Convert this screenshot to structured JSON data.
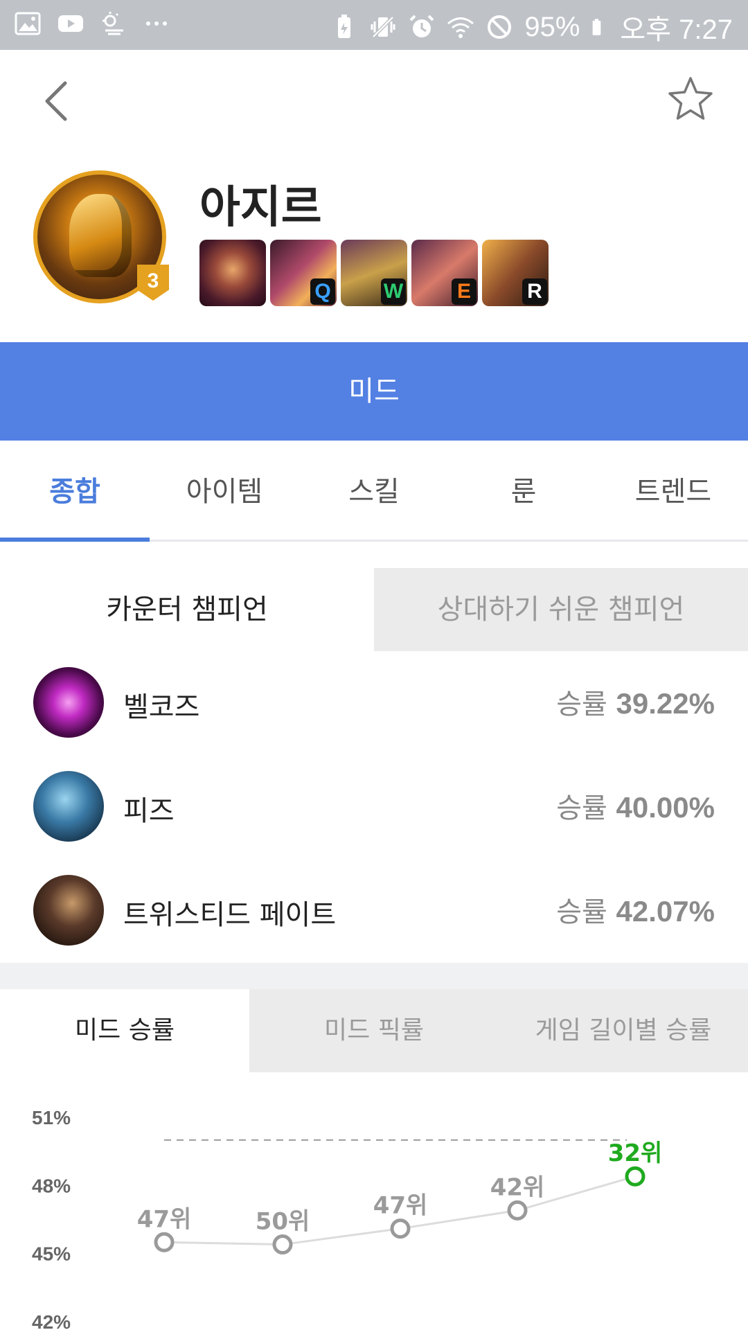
{
  "status_bar": {
    "battery": "95%",
    "time": "오후 7:27",
    "left_icons": [
      "image-icon",
      "youtube-icon",
      "weather-icon",
      "more-dots-icon"
    ],
    "right_icons": [
      "battery-saver-icon",
      "vibrate-icon",
      "alarm-icon",
      "wifi-icon",
      "blocked-icon",
      "battery-icon"
    ]
  },
  "header": {
    "back_icon": "chevron-left-icon",
    "favorite_icon": "star-outline-icon"
  },
  "champion": {
    "name": "아지르",
    "level_badge": "3",
    "skills": [
      {
        "key": "",
        "icon": "passive-skill-icon"
      },
      {
        "key": "Q",
        "color": "#3aa0ff",
        "icon": "q-skill-icon"
      },
      {
        "key": "W",
        "color": "#2ecc71",
        "icon": "w-skill-icon"
      },
      {
        "key": "E",
        "color": "#ff7a1a",
        "icon": "e-skill-icon"
      },
      {
        "key": "R",
        "color": "#ffffff",
        "icon": "r-skill-icon"
      }
    ]
  },
  "position_bar": {
    "label": "미드",
    "color": "#5380e3"
  },
  "tabs": [
    {
      "label": "종합",
      "active": true
    },
    {
      "label": "아이템",
      "active": false
    },
    {
      "label": "스킬",
      "active": false
    },
    {
      "label": "룬",
      "active": false
    },
    {
      "label": "트렌드",
      "active": false
    }
  ],
  "counter_toggle": {
    "selected": "카운터 챔피언",
    "other": "상대하기 쉬운 챔피언"
  },
  "counters": [
    {
      "name": "벨코즈",
      "win_label": "승률",
      "win_rate": "39.22%"
    },
    {
      "name": "피즈",
      "win_label": "승률",
      "win_rate": "40.00%"
    },
    {
      "name": "트위스티드 페이트",
      "win_label": "승률",
      "win_rate": "42.07%"
    }
  ],
  "chart_toggle": [
    {
      "label": "미드 승률",
      "active": true
    },
    {
      "label": "미드 픽률",
      "active": false
    },
    {
      "label": "게임 길이별 승률",
      "active": false
    }
  ],
  "chart_data": {
    "type": "line",
    "title": "",
    "xlabel": "",
    "ylabel": "",
    "y_tick_labels": [
      "51%",
      "48%",
      "45%",
      "42%"
    ],
    "ylim": [
      42,
      51
    ],
    "reference_line": 50,
    "series": [
      {
        "values": [
          45.5,
          45.4,
          46.1,
          46.9,
          48.4
        ],
        "point_labels": [
          "47위",
          "50위",
          "47위",
          "42위",
          "32위"
        ]
      }
    ],
    "colors": {
      "line": "#dcdcdc",
      "point": "#9a9a9a",
      "highlight": "#1faa1f"
    }
  }
}
